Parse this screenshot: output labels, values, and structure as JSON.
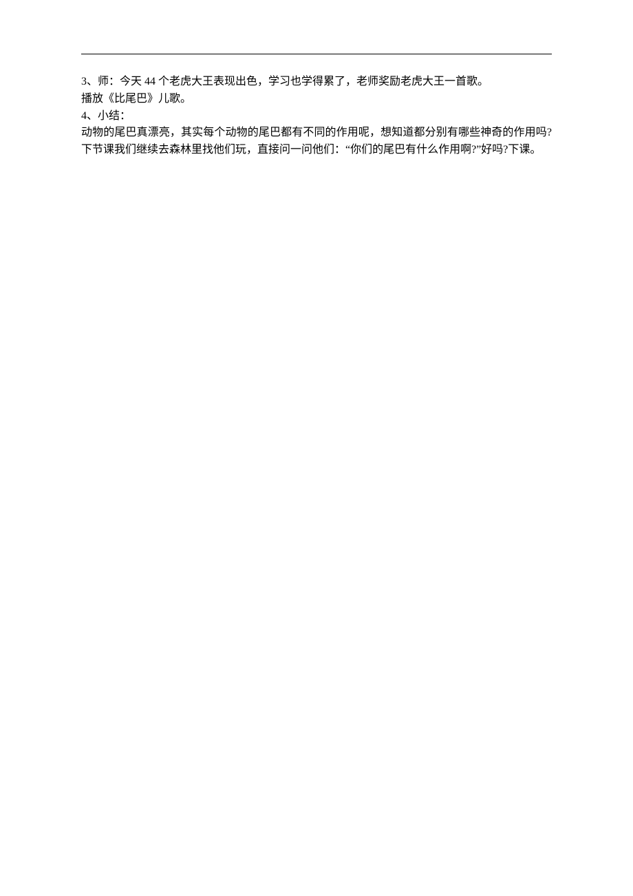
{
  "content": {
    "line1_prefix": "3",
    "line1_sep": "、师：今天 ",
    "line1_num": "44",
    "line1_rest": " 个老虎大王表现出色，学习也学得累了，老师奖励老虎大王一首歌。",
    "line2": "播放《比尾巴》儿歌。",
    "line3_prefix": "4",
    "line3_rest": "、小结：",
    "line4": "动物的尾巴真漂亮，其实每个动物的尾巴都有不同的作用呢，想知道都分别有哪些神奇的作用吗?下节课我们继续去森林里找他们玩，直接问一问他们：“你们的尾巴有什么作用啊?”好吗?下课。"
  }
}
